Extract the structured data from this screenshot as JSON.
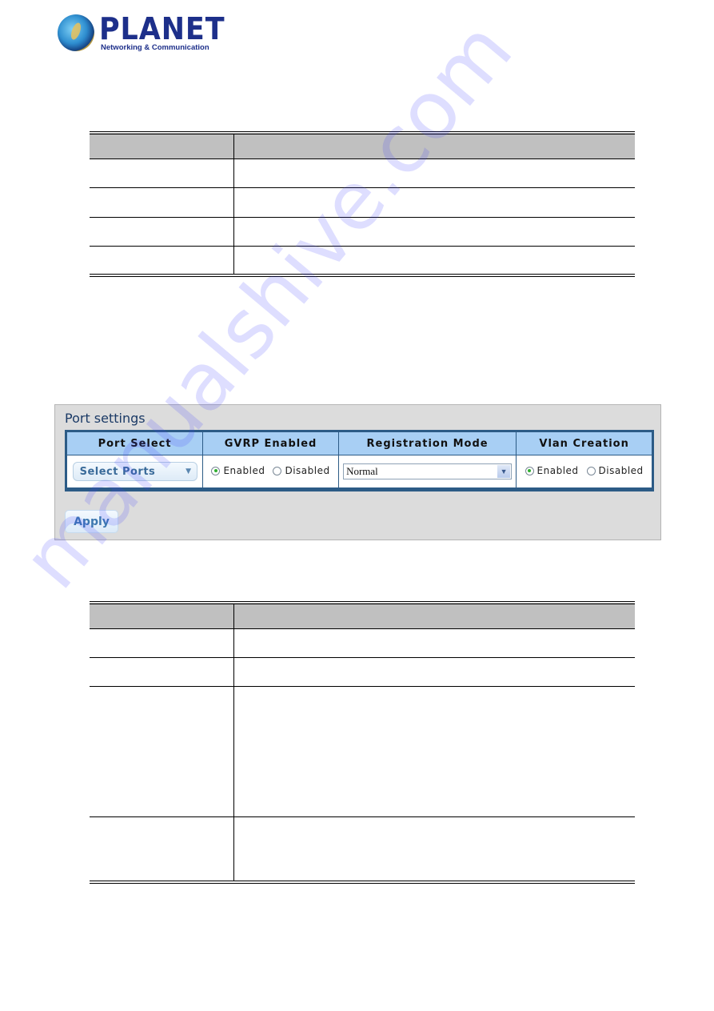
{
  "logo": {
    "name": "PLANET",
    "tagline": "Networking & Communication"
  },
  "table1": {
    "rows": [
      {
        "c1": "",
        "c2": ""
      },
      {
        "c1": "",
        "c2": ""
      },
      {
        "c1": "",
        "c2": ""
      },
      {
        "c1": "",
        "c2": ""
      },
      {
        "c1": "",
        "c2": ""
      }
    ]
  },
  "port_settings": {
    "title": "Port settings",
    "columns": [
      "Port Select",
      "GVRP Enabled",
      "Registration Mode",
      "Vlan Creation"
    ],
    "port_select": {
      "label": "Select Ports"
    },
    "gvrp": {
      "options": [
        "Enabled",
        "Disabled"
      ],
      "selected": "Enabled"
    },
    "registration_mode": {
      "value": "Normal"
    },
    "vlan_creation": {
      "options": [
        "Enabled",
        "Disabled"
      ],
      "selected": "Enabled"
    },
    "apply_label": "Apply"
  },
  "table2": {
    "rows": [
      {
        "c1": "",
        "c2": ""
      },
      {
        "c1": "",
        "c2": ""
      },
      {
        "c1": "",
        "c2": ""
      },
      {
        "c1": "",
        "c2": ""
      },
      {
        "c1": "",
        "c2": ""
      }
    ]
  },
  "watermark": "manualshive.com"
}
